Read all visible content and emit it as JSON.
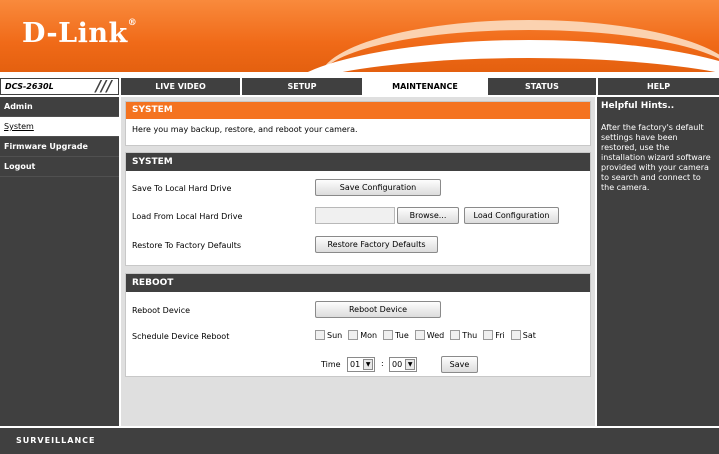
{
  "brand": {
    "logo": "D-Link",
    "reg": "®"
  },
  "model": "DCS-2630L",
  "tabs": [
    {
      "label": "LIVE VIDEO"
    },
    {
      "label": "SETUP"
    },
    {
      "label": "MAINTENANCE"
    },
    {
      "label": "STATUS"
    },
    {
      "label": "HELP"
    }
  ],
  "sidebar": {
    "items": [
      {
        "label": "Admin"
      },
      {
        "label": "System"
      },
      {
        "label": "Firmware Upgrade"
      },
      {
        "label": "Logout"
      }
    ]
  },
  "intro": {
    "title": "SYSTEM",
    "desc": "Here you may backup, restore, and reboot your camera."
  },
  "system": {
    "title": "SYSTEM",
    "save_label": "Save To Local Hard Drive",
    "save_button": "Save Configuration",
    "load_label": "Load From Local Hard Drive",
    "browse_button": "Browse...",
    "load_button": "Load Configuration",
    "restore_label": "Restore To Factory Defaults",
    "restore_button": "Restore Factory Defaults"
  },
  "reboot": {
    "title": "REBOOT",
    "device_label": "Reboot Device",
    "device_button": "Reboot Device",
    "schedule_label": "Schedule Device Reboot",
    "days": [
      "Sun",
      "Mon",
      "Tue",
      "Wed",
      "Thu",
      "Fri",
      "Sat"
    ],
    "time_label": "Time",
    "hour": "01",
    "minute": "00",
    "colon": ":",
    "save_button": "Save"
  },
  "help": {
    "title": "Helpful Hints..",
    "text": "After the factory's default settings have been restored, use the installation wizard software provided with your camera to search and connect to the camera."
  },
  "footer": {
    "label": "SURVEILLANCE"
  }
}
